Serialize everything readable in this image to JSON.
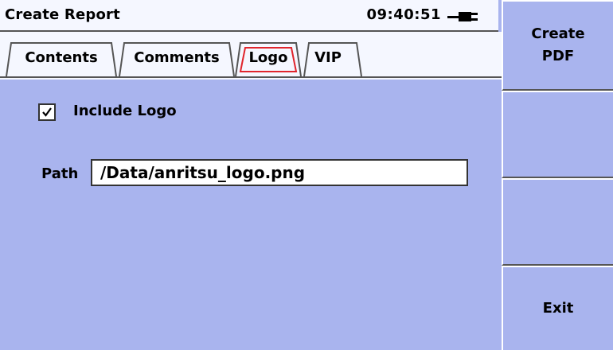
{
  "header": {
    "title": "Create Report",
    "time": "09:40:51"
  },
  "tabs": [
    {
      "label": "Contents",
      "active": false
    },
    {
      "label": "Comments",
      "active": false
    },
    {
      "label": "Logo",
      "active": true
    },
    {
      "label": "VIP",
      "active": false
    }
  ],
  "logo": {
    "include_label": "Include Logo",
    "include_checked": true,
    "path_label": "Path",
    "path_value": "/Data/anritsu_logo.png"
  },
  "sidebar": {
    "create_pdf_line1": "Create",
    "create_pdf_line2": "PDF",
    "exit_label": "Exit"
  },
  "colors": {
    "background": "#a9b4ee",
    "panel": "#f5f7ff",
    "active_tab_border": "#e0242c"
  },
  "icons": {
    "battery": "plug-icon",
    "check": "checkmark-icon"
  }
}
